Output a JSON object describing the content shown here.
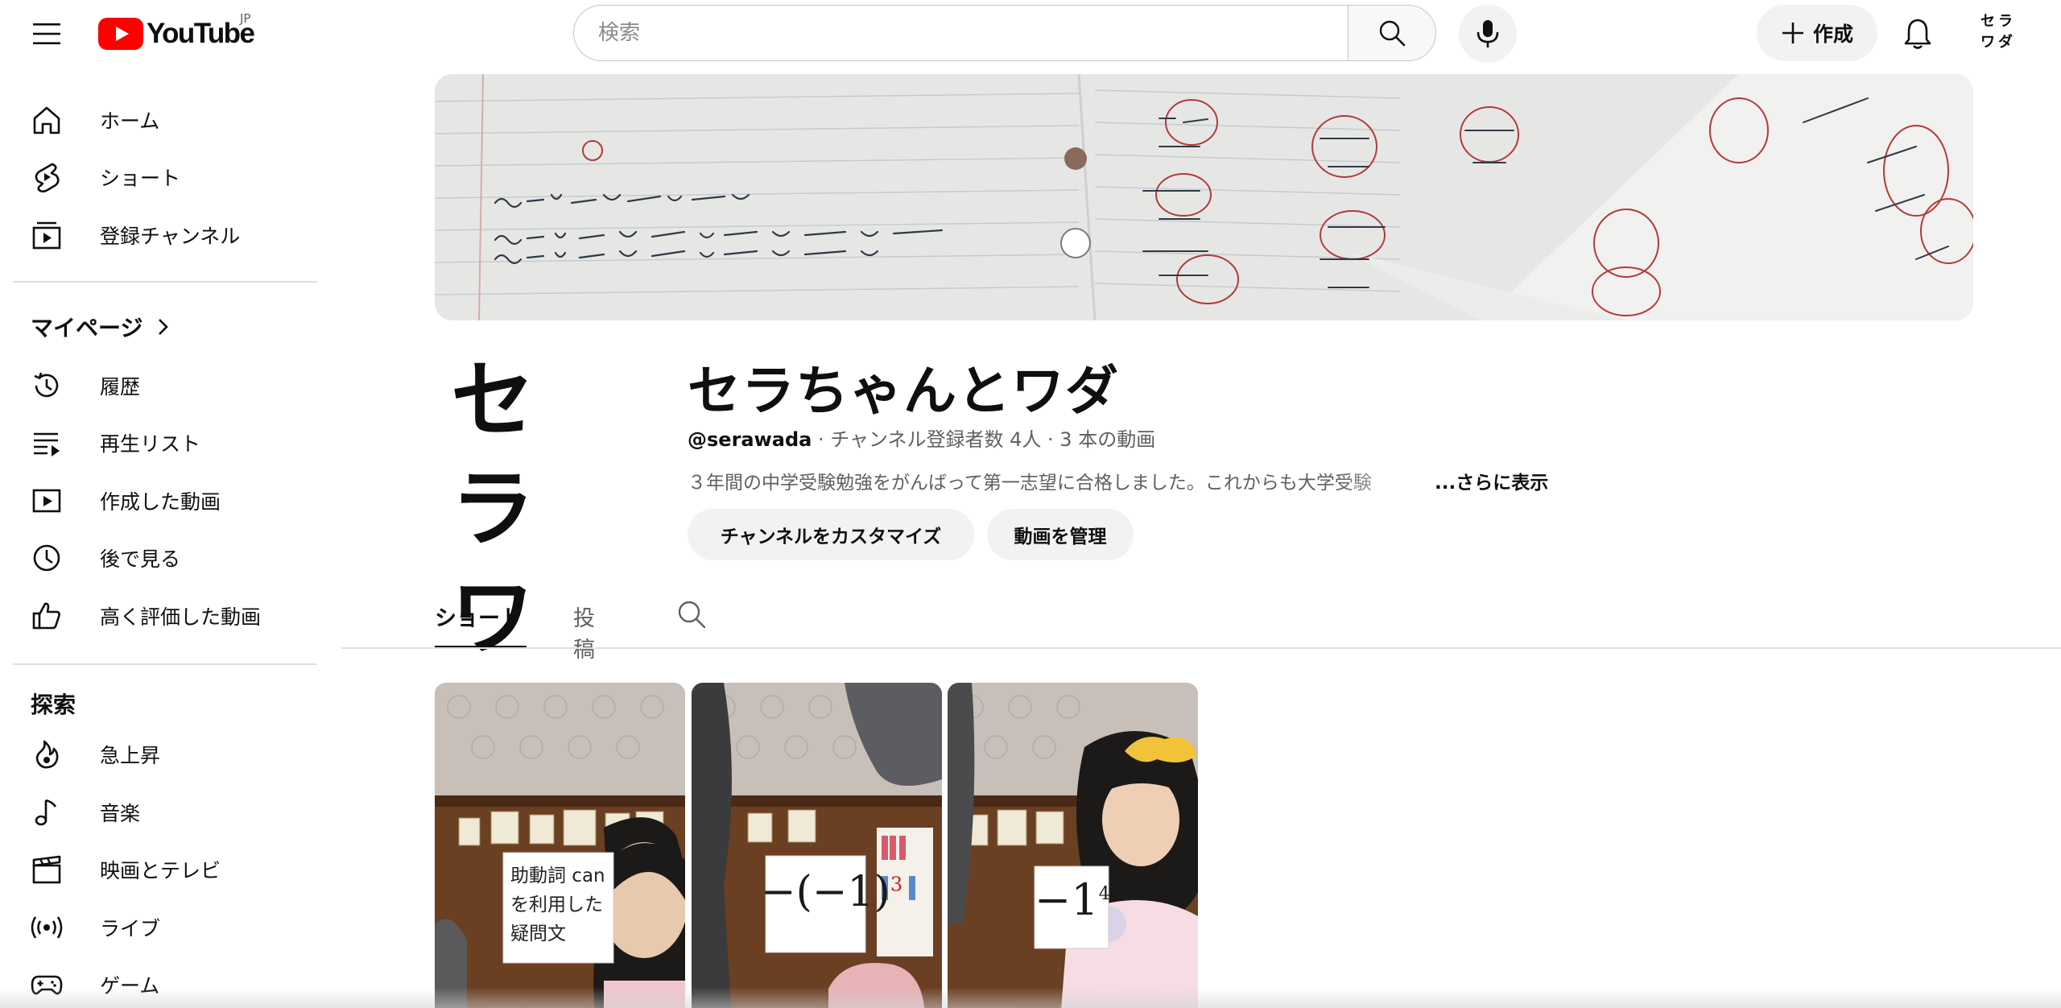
{
  "header": {
    "logo_text": "YouTube",
    "region": "JP",
    "search_placeholder": "検索",
    "create_label": "作成",
    "avatar_line1": "セラ",
    "avatar_line2": "ワダ"
  },
  "sidebar": {
    "top_items": [
      {
        "label": "ホーム",
        "icon": "home-icon"
      },
      {
        "label": "ショート",
        "icon": "shorts-icon"
      },
      {
        "label": "登録チャンネル",
        "icon": "subscriptions-icon"
      }
    ],
    "mypage_title": "マイページ",
    "mypage_items": [
      {
        "label": "履歴",
        "icon": "history-icon"
      },
      {
        "label": "再生リスト",
        "icon": "playlist-icon"
      },
      {
        "label": "作成した動画",
        "icon": "your-videos-icon"
      },
      {
        "label": "後で見る",
        "icon": "watch-later-icon"
      },
      {
        "label": "高く評価した動画",
        "icon": "liked-icon"
      }
    ],
    "explore_title": "探索",
    "explore_items": [
      {
        "label": "急上昇",
        "icon": "trending-icon"
      },
      {
        "label": "音楽",
        "icon": "music-icon"
      },
      {
        "label": "映画とテレビ",
        "icon": "movies-icon"
      },
      {
        "label": "ライブ",
        "icon": "live-icon"
      },
      {
        "label": "ゲーム",
        "icon": "gaming-icon"
      }
    ]
  },
  "channel": {
    "avatar_line1": "セラ",
    "avatar_line2": "ワダ",
    "name": "セラちゃんとワダ",
    "handle": "@serawada",
    "meta": " · チャンネル登録者数 4人 · 3 本の動画",
    "description": "３年間の中学受験勉強をがんばって第一志望に合格しました。これからも大学受験",
    "more_label": "...さらに表示",
    "customize_label": "チャンネルをカスタマイズ",
    "manage_label": "動画を管理"
  },
  "tabs": [
    {
      "label": "ショート",
      "active": true
    },
    {
      "label": "投稿",
      "active": false
    }
  ],
  "shorts": [
    {
      "card_text_1": "助動詞 can",
      "card_text_2": "を利用した",
      "card_text_3": "疑問文"
    },
    {
      "card_text": "−(−1)",
      "exponent": "3"
    },
    {
      "card_text": "−1",
      "exponent": "4"
    }
  ],
  "colors": {
    "youtube_red": "#ff0000",
    "text_primary": "#0f0f0f",
    "text_secondary": "#606060",
    "chip_bg": "#f2f2f2"
  }
}
